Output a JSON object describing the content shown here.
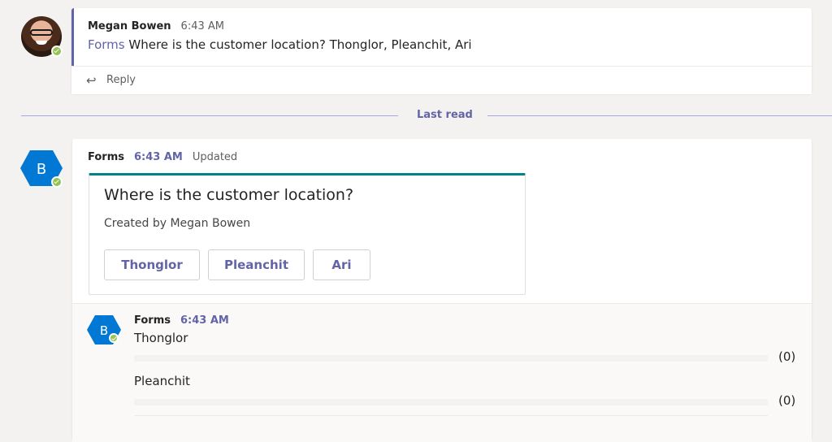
{
  "message1": {
    "sender": "Megan Bowen",
    "time": "6:43 AM",
    "app_link": "Forms",
    "text": "Where is the customer location? Thonglor, Pleanchit, Ari",
    "reply_label": "Reply"
  },
  "divider": {
    "label": "Last read"
  },
  "message2": {
    "sender": "Forms",
    "time": "6:43 AM",
    "status": "Updated",
    "avatar_letter": "B",
    "poll": {
      "question": "Where is the customer location?",
      "created_by": "Created by Megan Bowen",
      "options": [
        "Thonglor",
        "Pleanchit",
        "Ari"
      ]
    }
  },
  "reply1": {
    "sender": "Forms",
    "time": "6:43 AM",
    "avatar_letter": "B",
    "results": [
      {
        "label": "Thonglor",
        "count_text": "(0)",
        "fraction": 0
      },
      {
        "label": "Pleanchit",
        "count_text": "(0)",
        "fraction": 0
      }
    ]
  },
  "colors": {
    "accent": "#6264a7",
    "forms_blue": "#0078d4",
    "poll_top_border": "#038387",
    "presence_green": "#92c353"
  },
  "icons": {
    "reply": "reply-arrow-icon",
    "presence": "available-check-icon",
    "forms_avatar": "hexagon-letter-icon"
  }
}
